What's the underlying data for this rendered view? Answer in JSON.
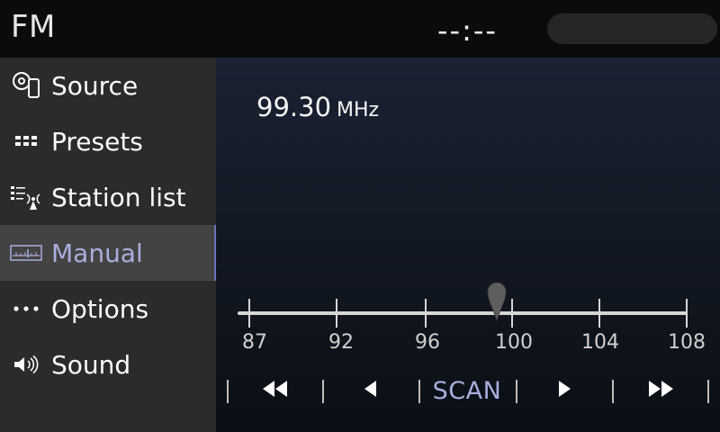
{
  "header": {
    "title": "FM",
    "clock": "--:--"
  },
  "sidebar": {
    "items": [
      {
        "label": "Source",
        "icon": "source-icon"
      },
      {
        "label": "Presets",
        "icon": "presets-icon"
      },
      {
        "label": "Station list",
        "icon": "station-list-icon"
      },
      {
        "label": "Manual",
        "icon": "manual-tune-icon",
        "active": true
      },
      {
        "label": "Options",
        "icon": "options-icon"
      },
      {
        "label": "Sound",
        "icon": "speaker-icon"
      }
    ]
  },
  "tuner": {
    "frequency": "99.30",
    "unit": "MHz",
    "scale": [
      "87",
      "92",
      "96",
      "100",
      "104",
      "108"
    ],
    "current_value": 99.3
  },
  "controls": {
    "scan_label": "SCAN",
    "icons": [
      "seek-back-icon",
      "step-back-icon",
      "step-forward-icon",
      "seek-forward-icon"
    ]
  },
  "colors": {
    "accent": "#a9aede",
    "sidebar": "#2b2b2b",
    "active_item": "#434343"
  }
}
